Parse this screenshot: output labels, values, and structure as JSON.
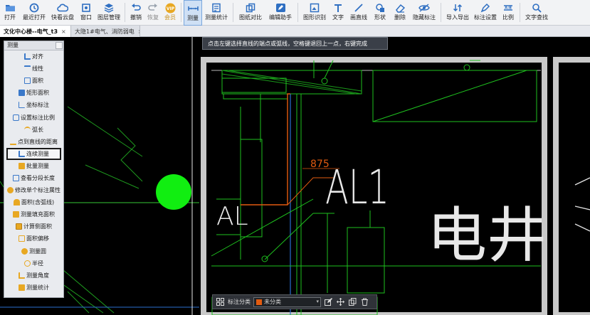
{
  "toolbar": {
    "items": [
      {
        "label": "打开",
        "icon": "folder-open-icon"
      },
      {
        "label": "最近打开",
        "icon": "recent-clock-icon"
      },
      {
        "label": "快看云盘",
        "icon": "cloud-icon"
      },
      {
        "label": "窗口",
        "icon": "window-icon"
      },
      {
        "label": "图层管理",
        "icon": "layers-icon"
      },
      {
        "label": "撤销",
        "icon": "undo-icon"
      },
      {
        "label": "恢复",
        "icon": "redo-icon"
      },
      {
        "label": "会员",
        "icon": "vip-icon",
        "badge": "VIP"
      },
      {
        "label": "测量",
        "icon": "measure-icon"
      },
      {
        "label": "测量统计",
        "icon": "measure-stats-icon"
      },
      {
        "label": "图纸对比",
        "icon": "compare-icon"
      },
      {
        "label": "编辑助手",
        "icon": "edit-assistant-icon"
      },
      {
        "label": "图形识别",
        "icon": "shape-recognition-icon"
      },
      {
        "label": "文字",
        "icon": "text-icon"
      },
      {
        "label": "画直线",
        "icon": "line-icon"
      },
      {
        "label": "形状",
        "icon": "shape-icon"
      },
      {
        "label": "删除",
        "icon": "eraser-icon"
      },
      {
        "label": "隐藏标注",
        "icon": "hide-annotation-icon"
      },
      {
        "label": "导入导出",
        "icon": "import-export-icon"
      },
      {
        "label": "标注设置",
        "icon": "annotation-settings-icon"
      },
      {
        "label": "比例",
        "icon": "scale-icon"
      },
      {
        "label": "文字查找",
        "icon": "text-search-icon"
      }
    ]
  },
  "tabs": [
    {
      "label": "文化中心楼--电气_t3",
      "active": true
    },
    {
      "label": "大隐1#电气、消防弱电",
      "active": false
    }
  ],
  "tab_close": "×",
  "panel": {
    "title": "测量",
    "items": [
      {
        "label": "对齐",
        "icon": "align-icon"
      },
      {
        "label": "线性",
        "icon": "linear-icon"
      },
      {
        "label": "面积",
        "icon": "area-icon"
      },
      {
        "label": "矩形面积",
        "icon": "rect-area-icon"
      },
      {
        "label": "坐标标注",
        "icon": "coordinate-icon"
      },
      {
        "label": "设置标注比例",
        "icon": "scale-set-icon"
      },
      {
        "label": "弧长",
        "icon": "arc-length-icon"
      },
      {
        "label": "点到直线的距离",
        "icon": "point-line-distance-icon"
      },
      {
        "label": "连续测量",
        "icon": "continuous-measure-icon",
        "selected": true
      },
      {
        "label": "批量测量",
        "icon": "batch-measure-icon"
      },
      {
        "label": "查看分段长度",
        "icon": "segment-length-icon"
      },
      {
        "label": "修改单个标注属性",
        "icon": "modify-annotation-icon"
      },
      {
        "label": "面积(含弧线)",
        "icon": "arc-area-icon"
      },
      {
        "label": "测量填充面积",
        "icon": "fill-area-icon"
      },
      {
        "label": "计算侧面积",
        "icon": "side-area-icon"
      },
      {
        "label": "面积偏移",
        "icon": "area-offset-icon"
      },
      {
        "label": "测量圆",
        "icon": "circle-measure-icon"
      },
      {
        "label": "半径",
        "icon": "radius-icon"
      },
      {
        "label": "测量角度",
        "icon": "angle-icon"
      },
      {
        "label": "测量统计",
        "icon": "measure-stats-icon"
      }
    ]
  },
  "tip": "点击左键选择直线的端点或弧线，空格键退回上一点，右键完成",
  "drawing": {
    "dimension_value": "875",
    "labels": [
      "AL",
      "AL1",
      "电井"
    ]
  },
  "bottombar": {
    "category_label": "标注分类",
    "category_value": "未分类"
  },
  "colors": {
    "accent": "#3a78c9",
    "canvas_bg": "#000000",
    "dimension": "#e25b10",
    "green_circle": "#11ee11"
  }
}
